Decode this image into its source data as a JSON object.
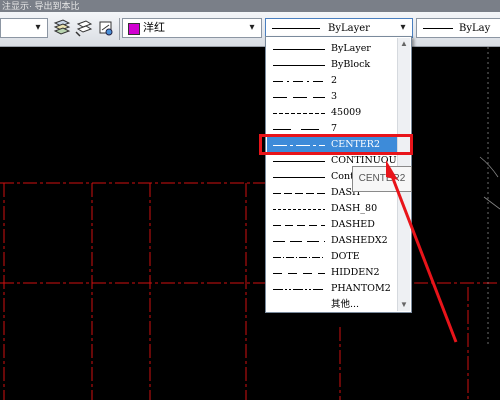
{
  "title_strip": {
    "text": "注显示· 导出到本比"
  },
  "toolbar": {
    "left_combo_arrow": "▾",
    "color": {
      "swatch_color": "#d100d1",
      "label": "洋红",
      "arrow": "▾"
    },
    "linetype": {
      "value": "ByLayer",
      "arrow": "▾"
    },
    "lineweight": {
      "value": "ByLay"
    }
  },
  "dropdown": {
    "items": [
      {
        "name": "ByLayer",
        "dash": "none"
      },
      {
        "name": "ByBlock",
        "dash": "none"
      },
      {
        "name": "2",
        "dash": "10 4 2 4"
      },
      {
        "name": "3",
        "dash": "14 6"
      },
      {
        "name": "45009",
        "dash": "4 2"
      },
      {
        "name": "7",
        "dash": "18 10"
      },
      {
        "name": "CENTER2",
        "dash": "14 3 3 3",
        "selected": true
      },
      {
        "name": "CONTINUOUS",
        "dash": "none"
      },
      {
        "name": "Cont",
        "dash": "none"
      },
      {
        "name": "DASH",
        "dash": "8 3"
      },
      {
        "name": "DASH_80",
        "dash": "3 2"
      },
      {
        "name": "DASHED",
        "dash": "8 4"
      },
      {
        "name": "DASHEDX2",
        "dash": "12 5"
      },
      {
        "name": "DOTE",
        "dash": "8 2 1 2"
      },
      {
        "name": "HIDDEN2",
        "dash": "9 6"
      },
      {
        "name": "PHANTOM2",
        "dash": "10 2 2 2 2 2"
      },
      {
        "name": "其他..."
      }
    ],
    "scroll_up": "▲",
    "scroll_down": "▼"
  },
  "tooltip": {
    "text": "CENTER2"
  },
  "colors": {
    "highlight": "#e8141a",
    "selection": "#3d8bd9",
    "drawing_lines": "#d01010"
  }
}
